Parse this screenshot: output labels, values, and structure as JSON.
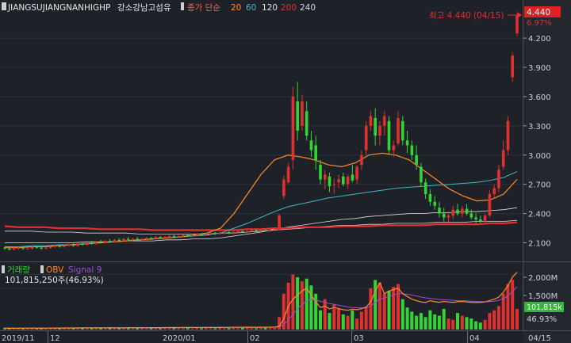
{
  "header": {
    "symbol": "JIANGSUJIANGNANHIGHP",
    "name": "강소강남고섬유",
    "price_label": "종가 단순",
    "ma_periods": [
      {
        "label": "20",
        "color": "#ff8c2a"
      },
      {
        "label": "60",
        "color": "#3fb6c8"
      },
      {
        "label": "120",
        "color": "#e0e0e0"
      },
      {
        "label": "200",
        "color": "#e03030"
      },
      {
        "label": "240",
        "color": "#d8d8d8"
      }
    ]
  },
  "price_panel": {
    "high_annotation": "최고 4.440 (04/15)",
    "current_price": "4.440",
    "change_pct": "6.97%",
    "y_ticks": [
      "4.200",
      "3.900",
      "3.600",
      "3.300",
      "3.000",
      "2.700",
      "2.400",
      "2.100"
    ]
  },
  "volume_panel": {
    "title": "거래량",
    "obv_label": "OBV",
    "signal_label": "Signal 9",
    "value": "101,815,250주(46.93%)",
    "y_ticks": [
      "2,000M",
      "1,500M"
    ],
    "current_obv": "101,815k",
    "current_pct": "46.93%"
  },
  "x_axis": {
    "labels": [
      "2019/11",
      "12",
      "2020/01",
      "02",
      "03",
      "04",
      "04/15"
    ]
  },
  "colors": {
    "background": "#1e2228",
    "up": "#e03030",
    "down": "#33d433",
    "ma20": "#ff8c2a",
    "ma60": "#3fb6c8",
    "ma120": "#e0e0e0",
    "ma200": "#e03030",
    "ma240": "#d8d8d8"
  },
  "chart_data": {
    "type": "candlestick",
    "y_range": [
      1.95,
      4.55
    ],
    "candles": [
      [
        2.05,
        2.06,
        2.03,
        2.04
      ],
      [
        2.04,
        2.05,
        2.02,
        2.03
      ],
      [
        2.03,
        2.05,
        2.02,
        2.04
      ],
      [
        2.04,
        2.06,
        2.03,
        2.05
      ],
      [
        2.05,
        2.06,
        2.03,
        2.04
      ],
      [
        2.04,
        2.05,
        2.03,
        2.04
      ],
      [
        2.04,
        2.07,
        2.03,
        2.06
      ],
      [
        2.06,
        2.07,
        2.04,
        2.05
      ],
      [
        2.05,
        2.06,
        2.03,
        2.04
      ],
      [
        2.04,
        2.06,
        2.03,
        2.05
      ],
      [
        2.05,
        2.07,
        2.04,
        2.06
      ],
      [
        2.06,
        2.08,
        2.05,
        2.07
      ],
      [
        2.07,
        2.08,
        2.05,
        2.06
      ],
      [
        2.06,
        2.08,
        2.05,
        2.07
      ],
      [
        2.07,
        2.09,
        2.06,
        2.08
      ],
      [
        2.08,
        2.1,
        2.06,
        2.07
      ],
      [
        2.07,
        2.1,
        2.06,
        2.09
      ],
      [
        2.09,
        2.11,
        2.07,
        2.08
      ],
      [
        2.08,
        2.11,
        2.07,
        2.1
      ],
      [
        2.1,
        2.12,
        2.08,
        2.09
      ],
      [
        2.09,
        2.12,
        2.08,
        2.11
      ],
      [
        2.11,
        2.13,
        2.09,
        2.1
      ],
      [
        2.1,
        2.13,
        2.09,
        2.12
      ],
      [
        2.12,
        2.14,
        2.1,
        2.11
      ],
      [
        2.11,
        2.14,
        2.1,
        2.13
      ],
      [
        2.13,
        2.15,
        2.11,
        2.12
      ],
      [
        2.12,
        2.15,
        2.11,
        2.14
      ],
      [
        2.14,
        2.16,
        2.12,
        2.13
      ],
      [
        2.13,
        2.15,
        2.12,
        2.14
      ],
      [
        2.14,
        2.16,
        2.12,
        2.13
      ],
      [
        2.13,
        2.15,
        2.12,
        2.14
      ],
      [
        2.14,
        2.16,
        2.13,
        2.15
      ],
      [
        2.15,
        2.16,
        2.13,
        2.14
      ],
      [
        2.14,
        2.17,
        2.13,
        2.16
      ],
      [
        2.16,
        2.17,
        2.14,
        2.15
      ],
      [
        2.15,
        2.17,
        2.14,
        2.16
      ],
      [
        2.16,
        2.18,
        2.15,
        2.17
      ],
      [
        2.17,
        2.18,
        2.15,
        2.16
      ],
      [
        2.16,
        2.18,
        2.15,
        2.17
      ],
      [
        2.17,
        2.19,
        2.16,
        2.18
      ],
      [
        2.18,
        2.19,
        2.16,
        2.17
      ],
      [
        2.17,
        2.19,
        2.16,
        2.18
      ],
      [
        2.18,
        2.2,
        2.17,
        2.19
      ],
      [
        2.19,
        2.2,
        2.17,
        2.18
      ],
      [
        2.18,
        2.2,
        2.17,
        2.19
      ],
      [
        2.19,
        2.21,
        2.18,
        2.2
      ],
      [
        2.2,
        2.21,
        2.18,
        2.19
      ],
      [
        2.19,
        2.21,
        2.18,
        2.2
      ],
      [
        2.2,
        2.22,
        2.19,
        2.21
      ],
      [
        2.21,
        2.22,
        2.19,
        2.2
      ],
      [
        2.2,
        2.22,
        2.19,
        2.21
      ],
      [
        2.21,
        2.23,
        2.2,
        2.22
      ],
      [
        2.22,
        2.23,
        2.2,
        2.21
      ],
      [
        2.21,
        2.23,
        2.2,
        2.22
      ],
      [
        2.22,
        2.24,
        2.21,
        2.23
      ],
      [
        2.23,
        2.24,
        2.21,
        2.22
      ],
      [
        2.22,
        2.24,
        2.21,
        2.23
      ],
      [
        2.23,
        2.24,
        2.21,
        2.22
      ],
      [
        2.22,
        2.24,
        2.21,
        2.23
      ],
      [
        2.23,
        2.24,
        2.22,
        2.23
      ],
      [
        2.23,
        2.4,
        2.22,
        2.38
      ],
      [
        2.58,
        2.79,
        2.55,
        2.75
      ],
      [
        2.72,
        2.92,
        2.7,
        2.88
      ],
      [
        2.95,
        3.7,
        2.85,
        3.6
      ],
      [
        3.55,
        3.75,
        3.15,
        3.25
      ],
      [
        3.3,
        3.62,
        3.25,
        3.55
      ],
      [
        3.45,
        3.55,
        3.15,
        3.2
      ],
      [
        3.15,
        3.25,
        2.98,
        3.05
      ],
      [
        3.1,
        3.2,
        2.85,
        2.95
      ],
      [
        2.9,
        2.95,
        2.7,
        2.75
      ],
      [
        2.75,
        2.85,
        2.65,
        2.8
      ],
      [
        2.78,
        2.82,
        2.62,
        2.68
      ],
      [
        2.7,
        2.76,
        2.6,
        2.7
      ],
      [
        2.72,
        2.8,
        2.66,
        2.75
      ],
      [
        2.78,
        2.82,
        2.68,
        2.7
      ],
      [
        2.7,
        2.8,
        2.65,
        2.78
      ],
      [
        2.8,
        2.9,
        2.72,
        2.74
      ],
      [
        2.75,
        2.9,
        2.7,
        2.88
      ],
      [
        2.9,
        3.05,
        2.85,
        3.0
      ],
      [
        3.05,
        3.35,
        3.0,
        3.3
      ],
      [
        3.3,
        3.45,
        3.25,
        3.4
      ],
      [
        3.38,
        3.48,
        3.1,
        3.2
      ],
      [
        3.2,
        3.35,
        3.1,
        3.3
      ],
      [
        3.3,
        3.45,
        3.2,
        3.4
      ],
      [
        3.35,
        3.4,
        3.0,
        3.05
      ],
      [
        3.05,
        3.15,
        2.98,
        3.1
      ],
      [
        3.12,
        3.45,
        3.1,
        3.38
      ],
      [
        3.35,
        3.4,
        3.1,
        3.15
      ],
      [
        3.15,
        3.25,
        3.02,
        3.1
      ],
      [
        3.1,
        3.15,
        2.95,
        3.0
      ],
      [
        3.0,
        3.1,
        2.85,
        2.9
      ],
      [
        2.88,
        2.92,
        2.68,
        2.72
      ],
      [
        2.72,
        2.76,
        2.55,
        2.6
      ],
      [
        2.6,
        2.65,
        2.48,
        2.52
      ],
      [
        2.52,
        2.58,
        2.44,
        2.48
      ],
      [
        2.46,
        2.52,
        2.36,
        2.4
      ],
      [
        2.4,
        2.46,
        2.32,
        2.36
      ],
      [
        2.36,
        2.42,
        2.3,
        2.38
      ],
      [
        2.38,
        2.48,
        2.34,
        2.44
      ],
      [
        2.44,
        2.5,
        2.38,
        2.4
      ],
      [
        2.4,
        2.48,
        2.36,
        2.45
      ],
      [
        2.45,
        2.5,
        2.38,
        2.4
      ],
      [
        2.4,
        2.44,
        2.34,
        2.36
      ],
      [
        2.36,
        2.4,
        2.3,
        2.34
      ],
      [
        2.34,
        2.38,
        2.3,
        2.32
      ],
      [
        2.32,
        2.4,
        2.3,
        2.38
      ],
      [
        2.38,
        2.64,
        2.36,
        2.6
      ],
      [
        2.6,
        2.7,
        2.56,
        2.66
      ],
      [
        2.66,
        2.9,
        2.62,
        2.85
      ],
      [
        2.88,
        3.15,
        2.85,
        3.05
      ],
      [
        3.05,
        3.4,
        3.0,
        3.35
      ],
      [
        3.8,
        4.05,
        3.75,
        4.02
      ],
      [
        4.25,
        4.44,
        4.22,
        4.44
      ]
    ],
    "ma20": [
      2.05,
      2.05,
      2.06,
      2.06,
      2.07,
      2.08,
      2.09,
      2.1,
      2.11,
      2.12,
      2.13,
      2.14,
      2.15,
      2.16,
      2.18,
      2.2,
      2.25,
      2.4,
      2.6,
      2.8,
      2.95,
      3.0,
      2.98,
      2.95,
      2.9,
      2.88,
      2.92,
      3.0,
      3.02,
      3.0,
      2.95,
      2.85,
      2.75,
      2.65,
      2.58,
      2.53,
      2.54,
      2.6,
      2.75
    ],
    "ma60": [
      2.06,
      2.06,
      2.07,
      2.07,
      2.08,
      2.08,
      2.09,
      2.1,
      2.11,
      2.12,
      2.13,
      2.14,
      2.15,
      2.16,
      2.17,
      2.18,
      2.2,
      2.25,
      2.3,
      2.36,
      2.42,
      2.47,
      2.5,
      2.53,
      2.56,
      2.58,
      2.6,
      2.62,
      2.64,
      2.66,
      2.67,
      2.68,
      2.69,
      2.7,
      2.71,
      2.72,
      2.74,
      2.77,
      2.83
    ],
    "ma120": [
      2.1,
      2.1,
      2.1,
      2.1,
      2.1,
      2.1,
      2.11,
      2.11,
      2.11,
      2.12,
      2.12,
      2.12,
      2.13,
      2.13,
      2.14,
      2.14,
      2.15,
      2.17,
      2.19,
      2.21,
      2.24,
      2.26,
      2.28,
      2.3,
      2.32,
      2.34,
      2.35,
      2.37,
      2.38,
      2.39,
      2.4,
      2.4,
      2.41,
      2.41,
      2.42,
      2.42,
      2.43,
      2.44,
      2.46
    ],
    "ma200": [
      2.27,
      2.26,
      2.26,
      2.26,
      2.25,
      2.25,
      2.25,
      2.24,
      2.24,
      2.24,
      2.24,
      2.23,
      2.23,
      2.23,
      2.23,
      2.23,
      2.23,
      2.23,
      2.24,
      2.24,
      2.25,
      2.25,
      2.26,
      2.26,
      2.26,
      2.27,
      2.27,
      2.27,
      2.28,
      2.28,
      2.28,
      2.28,
      2.29,
      2.29,
      2.29,
      2.29,
      2.3,
      2.3,
      2.31
    ],
    "ma240": [
      2.22,
      2.22,
      2.22,
      2.21,
      2.21,
      2.21,
      2.2,
      2.2,
      2.2,
      2.2,
      2.19,
      2.19,
      2.19,
      2.19,
      2.19,
      2.19,
      2.2,
      2.2,
      2.21,
      2.22,
      2.23,
      2.24,
      2.25,
      2.26,
      2.27,
      2.28,
      2.28,
      2.29,
      2.29,
      2.3,
      2.3,
      2.3,
      2.31,
      2.31,
      2.31,
      2.32,
      2.32,
      2.32,
      2.33
    ],
    "volume_range": [
      0,
      2300
    ],
    "volume": [
      60,
      40,
      50,
      45,
      55,
      35,
      60,
      45,
      50,
      40,
      55,
      50,
      45,
      60,
      50,
      55,
      45,
      50,
      40,
      55,
      50,
      45,
      55,
      60,
      50,
      45,
      55,
      50,
      45,
      60,
      50,
      40,
      55,
      50,
      45,
      55,
      50,
      60,
      45,
      50,
      55,
      45,
      60,
      50,
      55,
      45,
      50,
      60,
      45,
      55,
      50,
      45,
      60,
      55,
      50,
      45,
      55,
      60,
      50,
      55,
      450,
      1300,
      1700,
      2000,
      1900,
      1750,
      1850,
      1600,
      1300,
      700,
      1100,
      600,
      900,
      750,
      550,
      500,
      700,
      400,
      650,
      800,
      1500,
      1800,
      1700,
      1300,
      1400,
      1550,
      1650,
      1100,
      800,
      650,
      500,
      600,
      450,
      700,
      550,
      500,
      750,
      400,
      350,
      600,
      500,
      450,
      400,
      300,
      250,
      350,
      600,
      700,
      850,
      1300,
      1650,
      1800,
      750
    ],
    "obv": [
      50,
      45,
      48,
      46,
      50,
      48,
      52,
      50,
      52,
      50,
      53,
      55,
      54,
      56,
      58,
      57,
      59,
      60,
      59,
      61,
      62,
      61,
      63,
      65,
      64,
      62,
      64,
      66,
      65,
      67,
      68,
      66,
      68,
      70,
      69,
      71,
      72,
      74,
      72,
      74,
      76,
      74,
      77,
      79,
      78,
      76,
      78,
      80,
      79,
      81,
      82,
      80,
      83,
      85,
      84,
      82,
      84,
      86,
      85,
      87,
      120,
      380,
      850,
      1100,
      1250,
      1400,
      1500,
      1250,
      1000,
      800,
      850,
      750,
      800,
      760,
      720,
      700,
      740,
      720,
      760,
      820,
      1000,
      1400,
      1700,
      1300,
      1400,
      1450,
      1500,
      1300,
      1200,
      1100,
      1050,
      1000,
      980,
      1050,
      1010,
      990,
      1020,
      1000,
      990,
      1010,
      1020,
      1000,
      990,
      980,
      990,
      1000,
      1050,
      1100,
      1180,
      1350,
      1600,
      1900,
      2080
    ],
    "signal": [
      50,
      48,
      48,
      47,
      48,
      48,
      49,
      50,
      50,
      50,
      51,
      52,
      52,
      53,
      54,
      55,
      56,
      57,
      57,
      58,
      59,
      59,
      60,
      61,
      62,
      62,
      62,
      63,
      64,
      64,
      65,
      65,
      66,
      67,
      67,
      68,
      69,
      70,
      70,
      71,
      72,
      72,
      73,
      74,
      75,
      75,
      75,
      76,
      77,
      77,
      78,
      78,
      79,
      80,
      81,
      81,
      81,
      82,
      83,
      83,
      95,
      180,
      350,
      550,
      750,
      900,
      1050,
      1100,
      1080,
      1020,
      980,
      940,
      910,
      880,
      850,
      820,
      800,
      790,
      785,
      790,
      850,
      980,
      1100,
      1150,
      1200,
      1250,
      1300,
      1300,
      1280,
      1250,
      1220,
      1180,
      1150,
      1130,
      1110,
      1090,
      1080,
      1070,
      1060,
      1050,
      1045,
      1040,
      1030,
      1020,
      1015,
      1010,
      1015,
      1030,
      1060,
      1120,
      1220,
      1380,
      1560
    ]
  }
}
